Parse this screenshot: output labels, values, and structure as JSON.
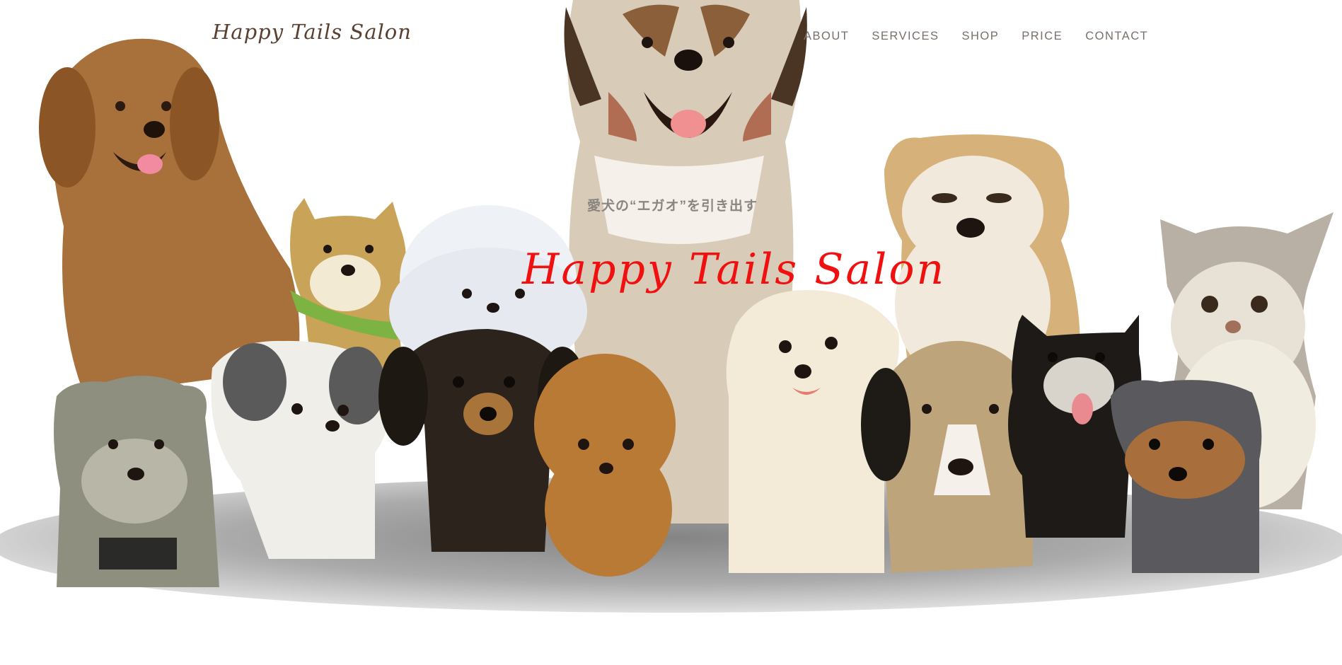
{
  "header": {
    "logo_text": "Happy Tails Salon"
  },
  "nav": {
    "items": [
      {
        "label": "ABOUT"
      },
      {
        "label": "SERVICES"
      },
      {
        "label": "SHOP"
      },
      {
        "label": "PRICE"
      },
      {
        "label": "CONTACT"
      }
    ]
  },
  "hero": {
    "tagline": "愛犬の“エガオ”を引き出す",
    "title": "Happy Tails Salon"
  },
  "colors": {
    "title_red": "#f01010",
    "logo_brown": "#5a4030",
    "nav_gray": "#7a6f6a",
    "shadow_gray": "#a8a8a8"
  },
  "illustration": {
    "subject": "group of illustrated dogs",
    "icons": [
      "dog-illustration"
    ]
  }
}
